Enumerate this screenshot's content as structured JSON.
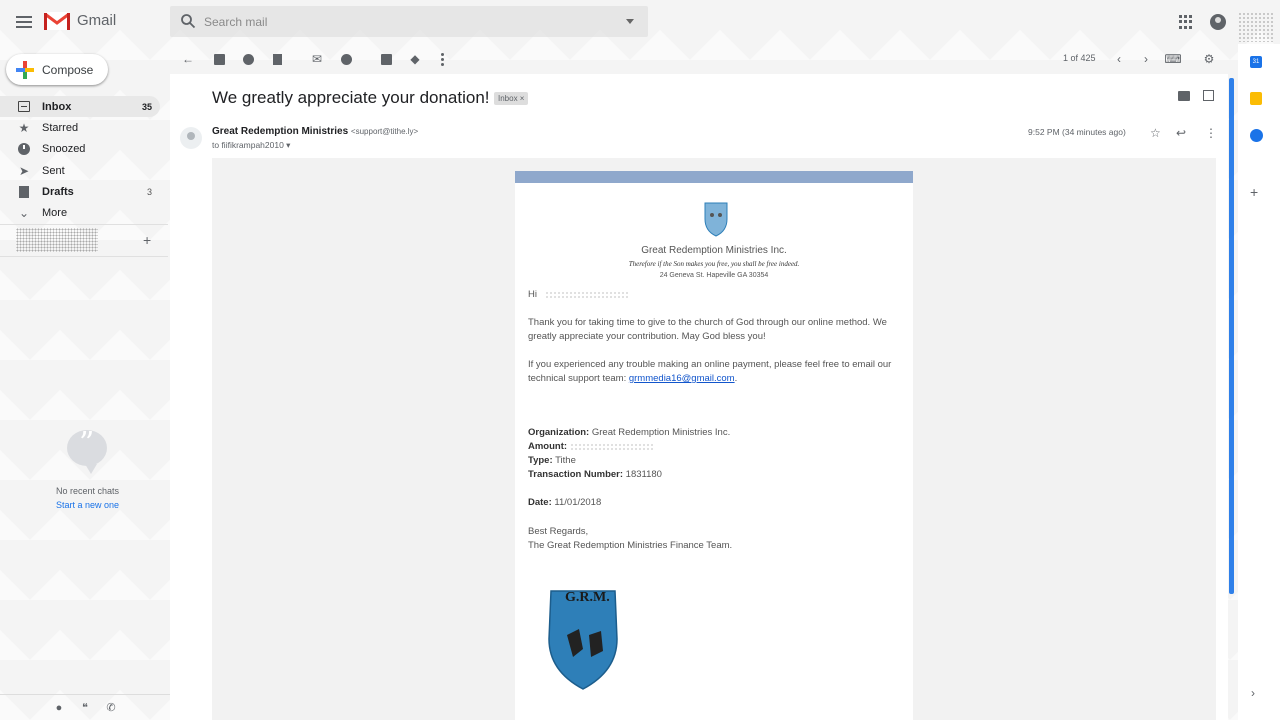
{
  "app": {
    "name": "Gmail"
  },
  "search": {
    "placeholder": "Search mail"
  },
  "compose": {
    "label": "Compose"
  },
  "nav": {
    "items": [
      {
        "label": "Inbox",
        "count": "35"
      },
      {
        "label": "Starred",
        "count": ""
      },
      {
        "label": "Snoozed",
        "count": ""
      },
      {
        "label": "Sent",
        "count": ""
      },
      {
        "label": "Drafts",
        "count": "3"
      },
      {
        "label": "More",
        "count": ""
      }
    ]
  },
  "hangouts": {
    "no_chats": "No recent chats",
    "start_new": "Start a new one"
  },
  "toolbar": {
    "pager": "1 of 425"
  },
  "message": {
    "subject": "We greatly appreciate your donation!",
    "label_chip": "Inbox ×",
    "sender_name": "Great Redemption Ministries",
    "sender_email": "<support@tithe.ly>",
    "to": "to fiifikrampah2010 ▾",
    "time": "9:52 PM (34 minutes ago)"
  },
  "email": {
    "org_title": "Great Redemption Ministries Inc.",
    "org_tagline": "Therefore if the Son makes you free, you shall be free indeed.",
    "org_address": "24 Geneva St. Hapeville GA 30354",
    "greeting": "Hi",
    "para1": "Thank you for taking time to give to the church of God through our online method. We greatly appreciate your contribution. May God bless you!",
    "para2_prefix": "If you experienced any trouble making an online payment, please feel free to email our technical support team: ",
    "para2_link": "grmmedia16@gmail.com",
    "para2_suffix": ".",
    "fields": {
      "organization_label": "Organization:",
      "organization_value": "Great Redemption Ministries Inc.",
      "amount_label": "Amount:",
      "type_label": "Type:",
      "type_value": "Tithe",
      "txn_label": "Transaction Number:",
      "txn_value": "1831180",
      "date_label": "Date:",
      "date_value": "11/01/2018"
    },
    "closing1": "Best Regards,",
    "closing2": "The Great Redemption Ministries Finance Team.",
    "logo_text": "G.R.M."
  },
  "side_panel": {
    "calendar_day": "31"
  },
  "colors": {
    "accent": "#1a73e8",
    "card_top": "#8fa8cc",
    "crest": "#2e7fb8"
  }
}
